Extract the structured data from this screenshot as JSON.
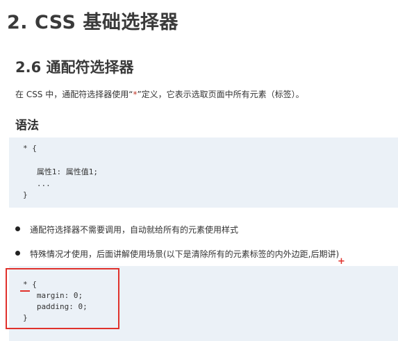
{
  "heading1": "2. CSS 基础选择器",
  "heading2": "2.6 通配符选择器",
  "intro": {
    "prefix": "在 CSS 中，通配符选择器使用“",
    "star": "*",
    "suffix": "”定义，它表示选取页面中所有元素（标签）。"
  },
  "syntax_heading": "语法",
  "code1": {
    "lines": [
      "* {",
      "",
      "   属性1: 属性值1;",
      "   ...",
      "}"
    ]
  },
  "bullets": [
    "通配符选择器不需要调用，自动就给所有的元素使用样式",
    "特殊情况才使用，后面讲解使用场景(以下是清除所有的元素标签的内外边距,后期讲)"
  ],
  "code2": {
    "lines": [
      "* {",
      "   margin: 0;",
      "   padding: 0;",
      "}"
    ]
  },
  "annotations": {
    "plus": "+",
    "color": "#e0312b"
  }
}
